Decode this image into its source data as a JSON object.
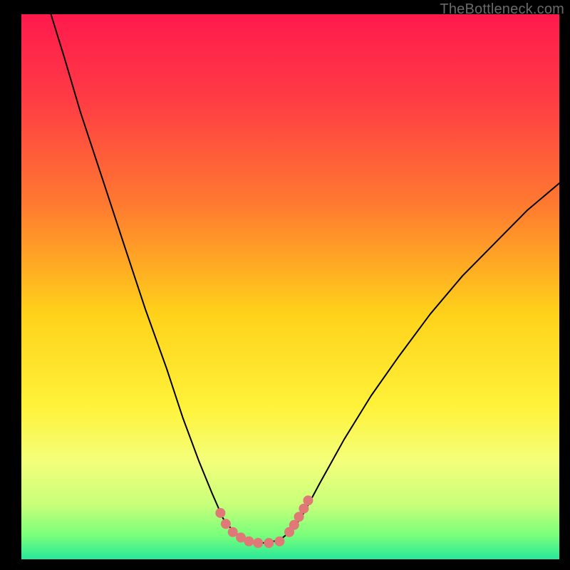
{
  "watermark": "TheBottleneck.com",
  "chart_data": {
    "type": "line",
    "title": "",
    "xlabel": "",
    "ylabel": "",
    "xlim": [
      0,
      1
    ],
    "ylim": [
      0,
      1
    ],
    "background_gradient": {
      "direction": "vertical",
      "stops": [
        {
          "offset": 0.0,
          "color": "#ff1a4d"
        },
        {
          "offset": 0.15,
          "color": "#ff3a45"
        },
        {
          "offset": 0.35,
          "color": "#ff7a30"
        },
        {
          "offset": 0.55,
          "color": "#ffd21a"
        },
        {
          "offset": 0.72,
          "color": "#fff23a"
        },
        {
          "offset": 0.82,
          "color": "#f4ff7a"
        },
        {
          "offset": 0.9,
          "color": "#c8ff7a"
        },
        {
          "offset": 0.955,
          "color": "#7aff7a"
        },
        {
          "offset": 1.0,
          "color": "#28e89a"
        }
      ]
    },
    "series": [
      {
        "name": "curve",
        "color": "#000000",
        "width": 2,
        "points": [
          {
            "x": 0.055,
            "y": 1.0
          },
          {
            "x": 0.08,
            "y": 0.92
          },
          {
            "x": 0.11,
            "y": 0.82
          },
          {
            "x": 0.15,
            "y": 0.7
          },
          {
            "x": 0.19,
            "y": 0.58
          },
          {
            "x": 0.23,
            "y": 0.46
          },
          {
            "x": 0.27,
            "y": 0.35
          },
          {
            "x": 0.3,
            "y": 0.26
          },
          {
            "x": 0.33,
            "y": 0.18
          },
          {
            "x": 0.355,
            "y": 0.12
          },
          {
            "x": 0.375,
            "y": 0.075
          },
          {
            "x": 0.395,
            "y": 0.05
          },
          {
            "x": 0.42,
            "y": 0.035
          },
          {
            "x": 0.45,
            "y": 0.03
          },
          {
            "x": 0.48,
            "y": 0.035
          },
          {
            "x": 0.505,
            "y": 0.055
          },
          {
            "x": 0.525,
            "y": 0.085
          },
          {
            "x": 0.555,
            "y": 0.14
          },
          {
            "x": 0.6,
            "y": 0.22
          },
          {
            "x": 0.65,
            "y": 0.3
          },
          {
            "x": 0.7,
            "y": 0.37
          },
          {
            "x": 0.76,
            "y": 0.45
          },
          {
            "x": 0.82,
            "y": 0.52
          },
          {
            "x": 0.88,
            "y": 0.58
          },
          {
            "x": 0.94,
            "y": 0.64
          },
          {
            "x": 1.0,
            "y": 0.69
          }
        ]
      },
      {
        "name": "left-dotted-marker",
        "color": "#e07878",
        "style": "dotted",
        "width": 14,
        "points": [
          {
            "x": 0.37,
            "y": 0.085
          },
          {
            "x": 0.38,
            "y": 0.065
          },
          {
            "x": 0.393,
            "y": 0.05
          },
          {
            "x": 0.408,
            "y": 0.04
          },
          {
            "x": 0.423,
            "y": 0.033
          },
          {
            "x": 0.44,
            "y": 0.03
          },
          {
            "x": 0.46,
            "y": 0.03
          },
          {
            "x": 0.48,
            "y": 0.033
          }
        ]
      },
      {
        "name": "right-dotted-marker",
        "color": "#e07878",
        "style": "dotted",
        "width": 14,
        "points": [
          {
            "x": 0.498,
            "y": 0.05
          },
          {
            "x": 0.507,
            "y": 0.063
          },
          {
            "x": 0.516,
            "y": 0.078
          },
          {
            "x": 0.525,
            "y": 0.093
          },
          {
            "x": 0.533,
            "y": 0.108
          }
        ]
      }
    ]
  }
}
